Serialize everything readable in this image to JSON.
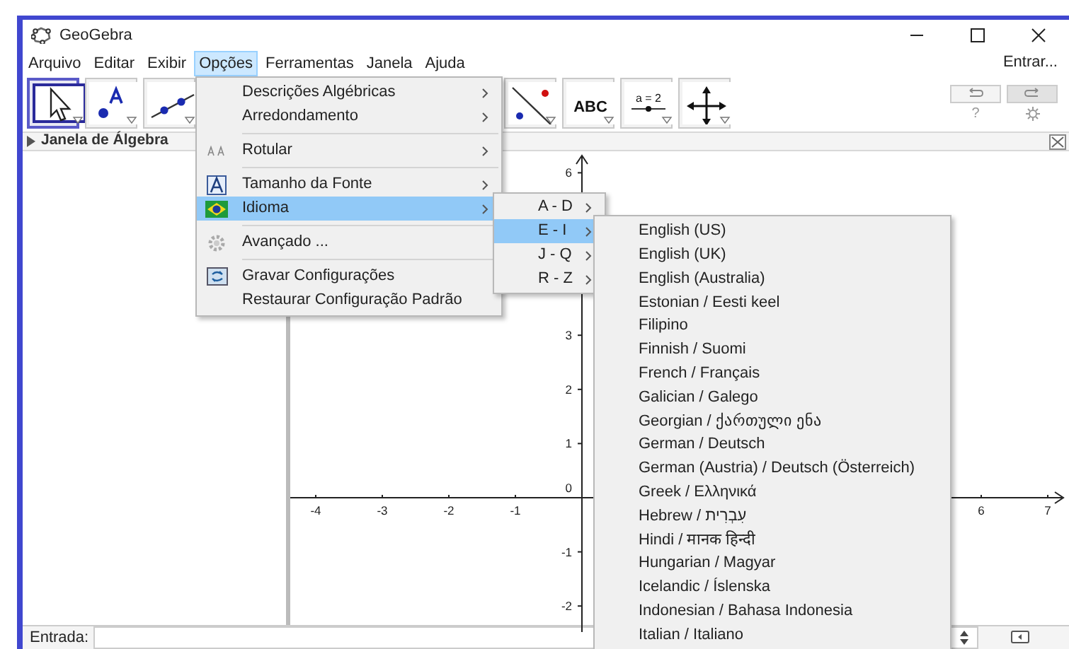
{
  "window": {
    "title": "GeoGebra"
  },
  "menubar": {
    "items": [
      {
        "label": "Arquivo",
        "selected": false
      },
      {
        "label": "Editar",
        "selected": false
      },
      {
        "label": "Exibir",
        "selected": false
      },
      {
        "label": "Opções",
        "selected": true
      },
      {
        "label": "Ferramentas",
        "selected": false
      },
      {
        "label": "Janela",
        "selected": false
      },
      {
        "label": "Ajuda",
        "selected": false
      }
    ],
    "login": "Entrar..."
  },
  "toolbar": {
    "tools": [
      {
        "kind": "move",
        "selected": true
      },
      {
        "kind": "point",
        "selected": false
      },
      {
        "kind": "line",
        "selected": false
      },
      {
        "kind": "perpendicular",
        "selected": false
      },
      {
        "kind": "text",
        "label": "ABC",
        "selected": false
      },
      {
        "kind": "slider",
        "label": "a = 2",
        "selected": false
      },
      {
        "kind": "move_view",
        "selected": false
      }
    ],
    "help": "?"
  },
  "algebra_view": {
    "title": "Janela de Álgebra"
  },
  "graphics_view": {
    "x_labels": [
      "-4",
      "-3",
      "-2",
      "-1",
      "6",
      "7"
    ],
    "y_labels": [
      "6",
      "3",
      "2",
      "1",
      "0",
      "-1",
      "-2"
    ]
  },
  "input_bar": {
    "label": "Entrada:"
  },
  "options_menu": {
    "items": [
      {
        "kind": "item",
        "label": "Descrições Algébricas",
        "submenu": true,
        "selected": false
      },
      {
        "kind": "item",
        "label": "Arredondamento",
        "submenu": true,
        "selected": false
      },
      {
        "kind": "separator"
      },
      {
        "kind": "item",
        "label": "Rotular",
        "submenu": true,
        "selected": false
      },
      {
        "kind": "separator"
      },
      {
        "kind": "item",
        "label": "Tamanho da Fonte",
        "submenu": true,
        "selected": false
      },
      {
        "kind": "item",
        "label": "Idioma",
        "submenu": true,
        "selected": true
      },
      {
        "kind": "separator"
      },
      {
        "kind": "item",
        "label": "Avançado ...",
        "submenu": false,
        "selected": false
      },
      {
        "kind": "separator"
      },
      {
        "kind": "item",
        "label": "Gravar Configurações",
        "submenu": false,
        "selected": false
      },
      {
        "kind": "item",
        "label": "Restaurar Configuração Padrão",
        "submenu": false,
        "selected": false
      }
    ]
  },
  "language_ranges": [
    {
      "label": "A - D",
      "selected": false
    },
    {
      "label": "E - I",
      "selected": true
    },
    {
      "label": "J - Q",
      "selected": false
    },
    {
      "label": "R - Z",
      "selected": false
    }
  ],
  "languages": [
    {
      "label": "English (US)",
      "selected": false
    },
    {
      "label": "English (UK)",
      "selected": false
    },
    {
      "label": "English (Australia)",
      "selected": false
    },
    {
      "label": "Estonian / Eesti keel",
      "selected": false
    },
    {
      "label": "Filipino",
      "selected": false
    },
    {
      "label": "Finnish / Suomi",
      "selected": false
    },
    {
      "label": "French / Français",
      "selected": false
    },
    {
      "label": "Galician / Galego",
      "selected": false
    },
    {
      "label": "Georgian / ქართული ენა",
      "selected": false
    },
    {
      "label": "German / Deutsch",
      "selected": false
    },
    {
      "label": "German (Austria) / Deutsch (Österreich)",
      "selected": false
    },
    {
      "label": "Greek / Ελληνικά",
      "selected": false
    },
    {
      "label": "Hebrew / עִבְרִית",
      "selected": false
    },
    {
      "label": "Hindi / मानक हिन्दी",
      "selected": false
    },
    {
      "label": "Hungarian / Magyar",
      "selected": false
    },
    {
      "label": "Icelandic / Íslenska",
      "selected": false
    },
    {
      "label": "Indonesian / Bahasa Indonesia",
      "selected": false
    },
    {
      "label": "Italian / Italiano",
      "selected": false
    }
  ]
}
